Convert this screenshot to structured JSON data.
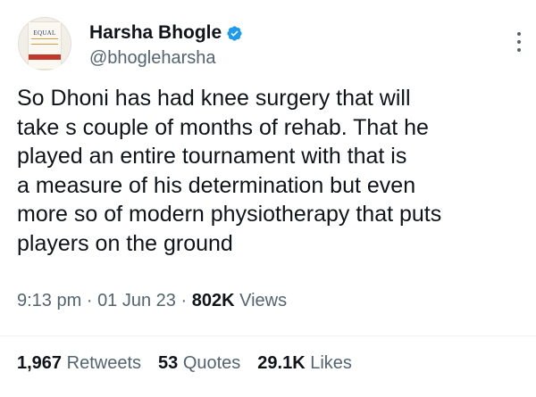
{
  "author": {
    "display_name": "Harsha Bhogle",
    "handle": "@bhogleharsha",
    "verified": true,
    "avatar_book_title": "EQUAL"
  },
  "tweet": {
    "lines": [
      "So Dhoni has had knee surgery that will",
      "take s couple of months of rehab. That he",
      "played an entire tournament with that is",
      "a measure of his determination but even",
      "more so of modern physiotherapy that puts",
      "players on the ground"
    ]
  },
  "meta": {
    "time": "9:13 pm",
    "date": "01 Jun 23",
    "separator": "·",
    "views_count": "802K",
    "views_label": "Views"
  },
  "stats": {
    "retweets_count": "1,967",
    "retweets_label": "Retweets",
    "quotes_count": "53",
    "quotes_label": "Quotes",
    "likes_count": "29.1K",
    "likes_label": "Likes"
  },
  "colors": {
    "verified": "#1d9bf0",
    "secondary_text": "#536471",
    "primary_text": "#0f1419"
  }
}
